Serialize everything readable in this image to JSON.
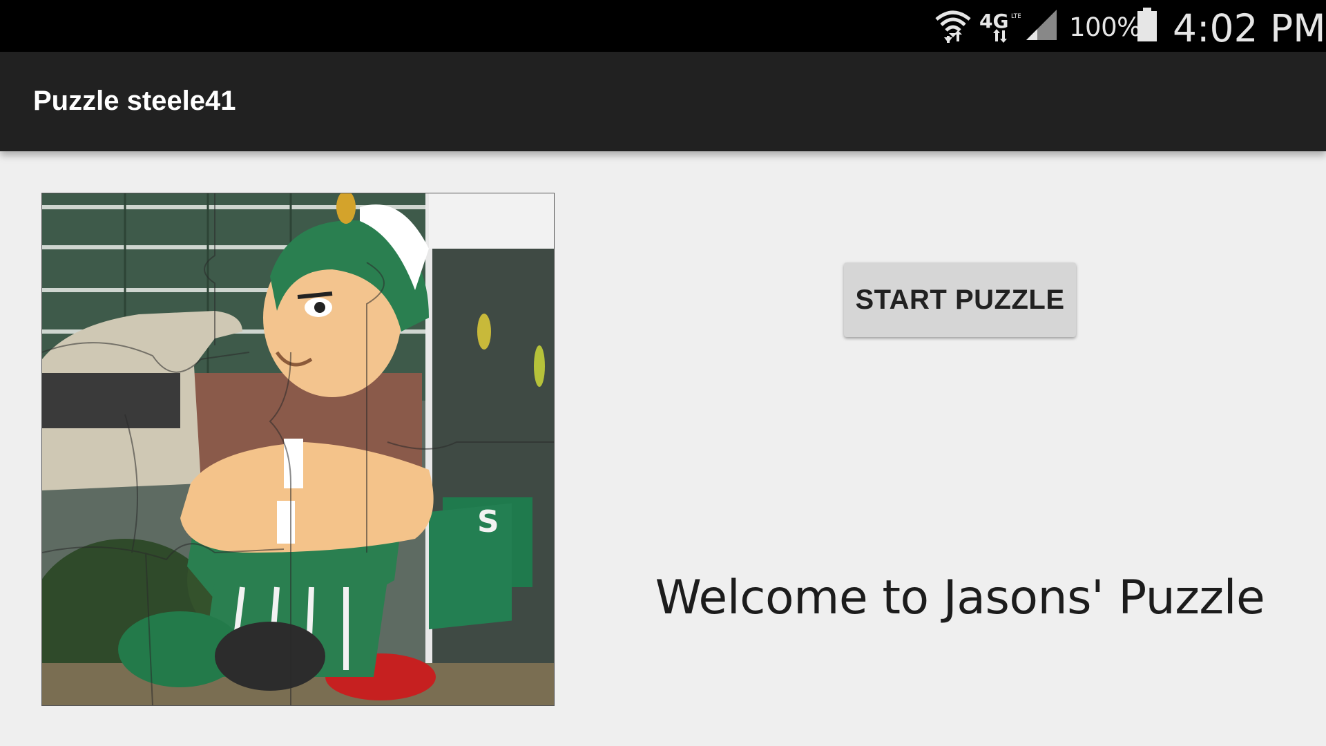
{
  "status_bar": {
    "battery_percent": "100%",
    "time": "4:02 PM",
    "network_label": "4G",
    "icons": [
      "wifi-icon",
      "lte-icon",
      "signal-icon",
      "battery-icon"
    ]
  },
  "app_bar": {
    "title": "Puzzle steele41"
  },
  "main": {
    "image": {
      "icon": "puzzle-preview-image",
      "badge_letter": "S"
    },
    "start_button_label": "START PUZZLE",
    "welcome_text": "Welcome to Jasons' Puzzle"
  },
  "colors": {
    "status_bar": "#000000",
    "app_bar": "#212121",
    "background": "#efefef",
    "button": "#d6d6d6",
    "spartan_green": "#1f7a4d"
  }
}
